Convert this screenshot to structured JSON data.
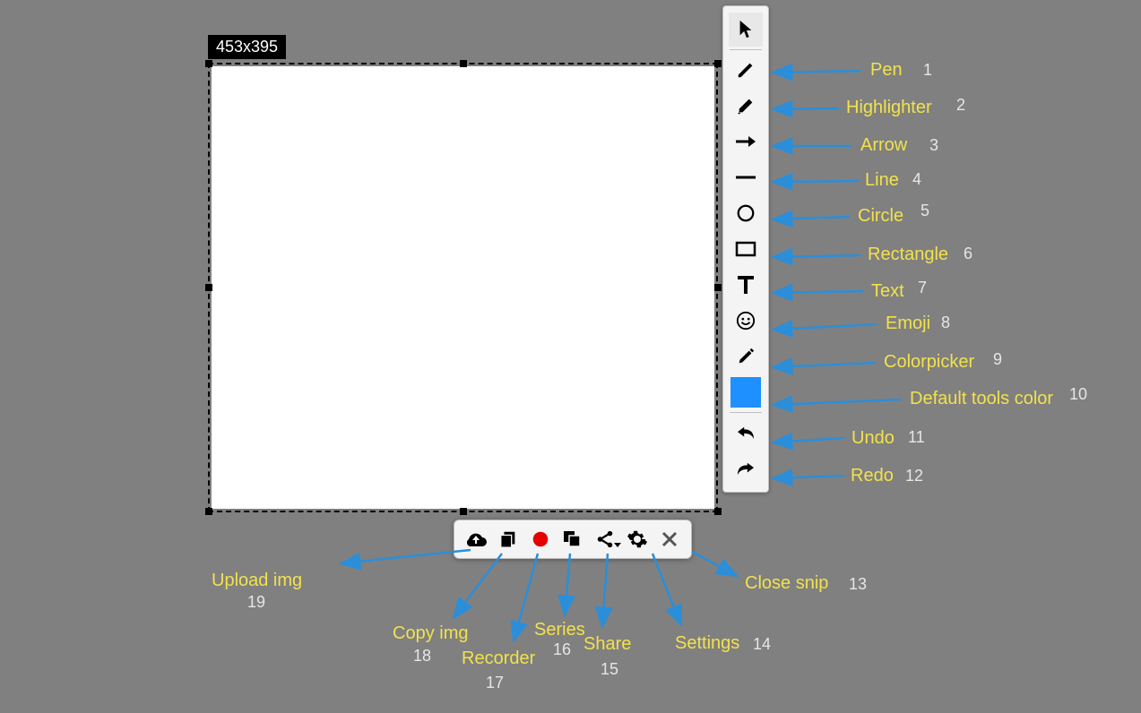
{
  "dimension_badge": "453x395",
  "side_tools": [
    {
      "name": "cursor",
      "divider_after": true
    },
    {
      "name": "pen",
      "label": "Pen",
      "num": "1"
    },
    {
      "name": "highlighter",
      "label": "Highlighter",
      "num": "2"
    },
    {
      "name": "arrow",
      "label": "Arrow",
      "num": "3"
    },
    {
      "name": "line",
      "label": "Line",
      "num": "4"
    },
    {
      "name": "circle",
      "label": "Circle",
      "num": "5"
    },
    {
      "name": "rectangle",
      "label": "Rectangle",
      "num": "6"
    },
    {
      "name": "text",
      "label": "Text",
      "num": "7"
    },
    {
      "name": "emoji",
      "label": "Emoji",
      "num": "8"
    },
    {
      "name": "colorpicker",
      "label": "Colorpicker",
      "num": "9"
    },
    {
      "name": "default-color",
      "label": "Default tools color",
      "num": "10",
      "color": "#1e90ff",
      "divider_before": true
    },
    {
      "name": "undo",
      "label": "Undo",
      "num": "11",
      "divider_before": true
    },
    {
      "name": "redo",
      "label": "Redo",
      "num": "12"
    }
  ],
  "bottom_tools": [
    {
      "name": "upload",
      "label": "Upload img",
      "num": "19"
    },
    {
      "name": "copy",
      "label": "Copy img",
      "num": "18"
    },
    {
      "name": "record",
      "label": "Recorder",
      "num": "17"
    },
    {
      "name": "series",
      "label": "Series",
      "num": "16"
    },
    {
      "name": "share",
      "label": "Share",
      "num": "15"
    },
    {
      "name": "settings",
      "label": "Settings",
      "num": "14"
    },
    {
      "name": "close",
      "label": "Close snip",
      "num": "13"
    }
  ]
}
